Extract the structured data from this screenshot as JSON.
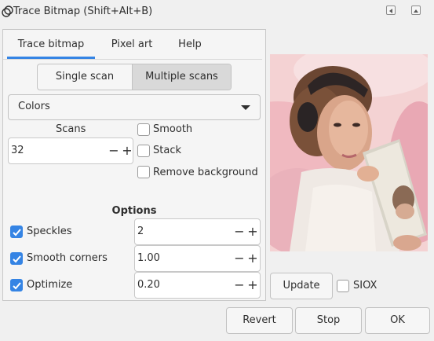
{
  "window": {
    "title": "Trace Bitmap (Shift+Alt+B)"
  },
  "tabs": [
    {
      "label": "Trace bitmap",
      "active": true
    },
    {
      "label": "Pixel art",
      "active": false
    },
    {
      "label": "Help",
      "active": false
    }
  ],
  "scan_mode": {
    "single_label": "Single scan",
    "multiple_label": "Multiple scans",
    "selected": "Multiple scans"
  },
  "mode_combo": {
    "value": "Colors"
  },
  "scans": {
    "label": "Scans",
    "value": "32",
    "minus": "−",
    "plus": "+"
  },
  "flags": {
    "smooth": {
      "label": "Smooth",
      "checked": false
    },
    "stack": {
      "label": "Stack",
      "checked": false
    },
    "remove_background": {
      "label": "Remove background",
      "checked": false
    }
  },
  "options": {
    "title": "Options",
    "speckles": {
      "label": "Speckles",
      "checked": true,
      "value": "2"
    },
    "smooth_corners": {
      "label": "Smooth corners",
      "checked": true,
      "value": "1.00"
    },
    "optimize": {
      "label": "Optimize",
      "checked": true,
      "value": "0.20"
    },
    "minus": "−",
    "plus": "+"
  },
  "preview": {
    "update_label": "Update",
    "siox": {
      "label": "SIOX",
      "checked": false
    }
  },
  "footer": {
    "revert_label": "Revert",
    "stop_label": "Stop",
    "ok_label": "OK"
  },
  "colors": {
    "accent": "#3584e4",
    "window_bg": "#f0f0f0"
  },
  "icons": {
    "app": "trace-bitmap-icon",
    "dropdown": "chevron-down-icon",
    "checkmark": "checkmark-icon"
  }
}
